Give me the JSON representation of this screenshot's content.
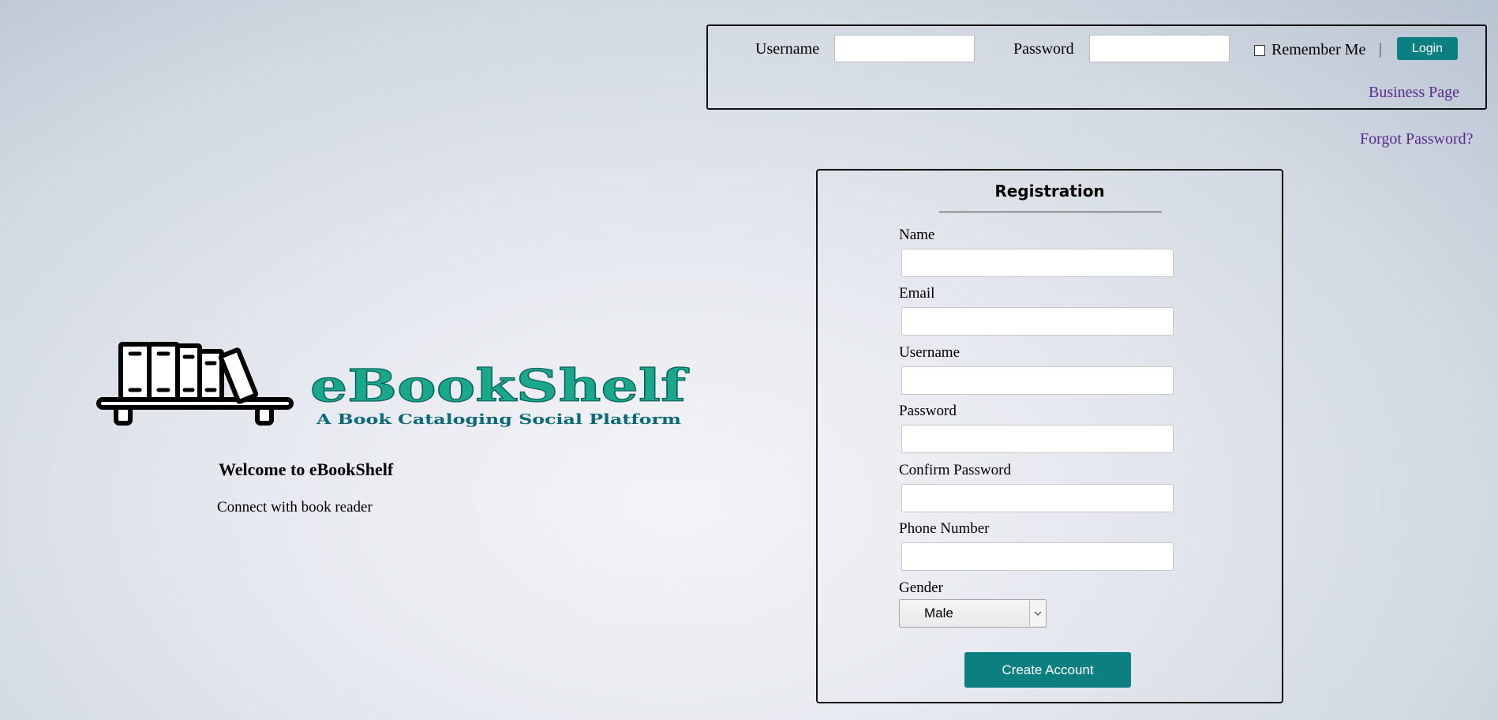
{
  "login": {
    "username_label": "Username",
    "username_value": "",
    "password_label": "Password",
    "password_value": "",
    "remember_label": "Remember Me",
    "remember_checked": false,
    "separator": "|",
    "login_button": "Login",
    "business_link": "Business Page",
    "forgot_link": "Forgot Password?"
  },
  "brand": {
    "logo_name": "eBookShelf",
    "tagline": "A Book Cataloging Social Platform",
    "welcome_title": "Welcome to eBookShelf",
    "welcome_subtitle": "Connect with book reader",
    "icon": "bookshelf-icon"
  },
  "registration": {
    "title": "Registration",
    "fields": [
      {
        "label": "Name",
        "value": ""
      },
      {
        "label": "Email",
        "value": ""
      },
      {
        "label": "Username",
        "value": ""
      },
      {
        "label": "Password",
        "value": ""
      },
      {
        "label": "Confirm Password",
        "value": ""
      },
      {
        "label": "Phone Number",
        "value": ""
      }
    ],
    "gender_label": "Gender",
    "gender_value": "Male",
    "submit_label": "Create Account"
  },
  "colors": {
    "accent": "#0c7f80",
    "link": "#5a2a8e",
    "logo_green": "#1aa88a",
    "logo_teal": "#0b6a78"
  }
}
